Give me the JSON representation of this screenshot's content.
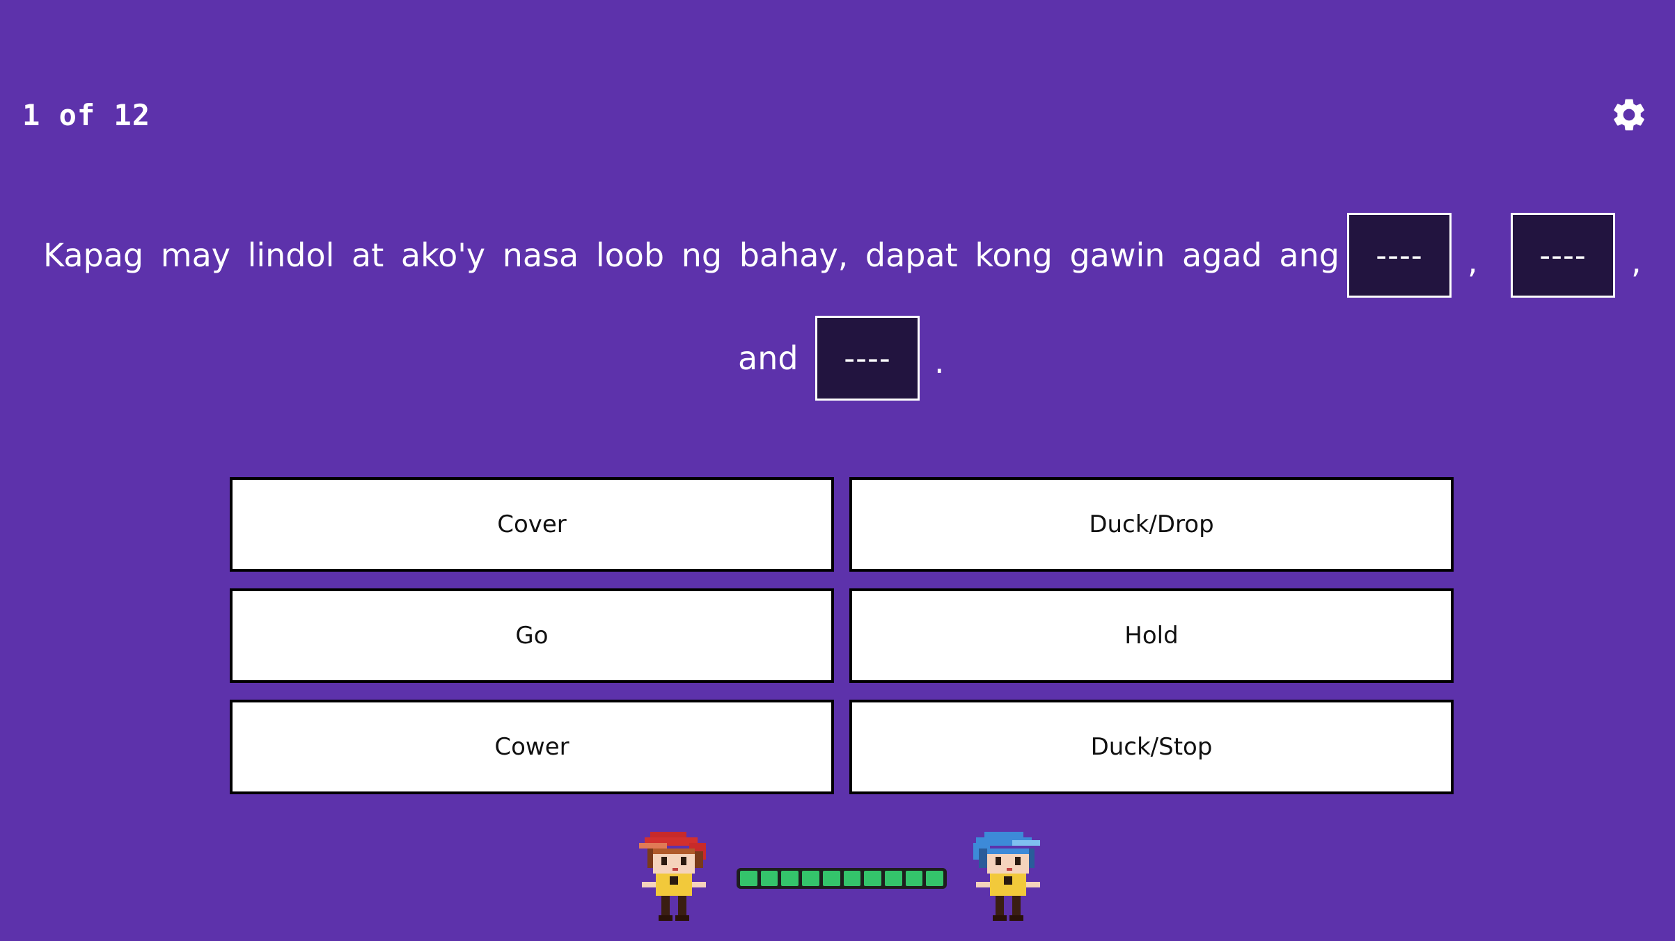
{
  "header": {
    "counter": "1 of 12"
  },
  "question": {
    "line1": "Kapag may lindol at ako'y nasa loob ng bahay, dapat kong gawin agad ang",
    "blank_text": "----",
    "comma": ",",
    "and_text": "and",
    "period": "."
  },
  "options": [
    "Cover",
    "Duck/Drop",
    "Go",
    "Hold",
    "Cower",
    "Duck/Stop"
  ],
  "footer": {
    "progress_fraction": 1.0,
    "progress_segments": 10
  },
  "colors": {
    "background": "#5d32ab",
    "blank_fill": "#22143f",
    "progress_green": "#34c46b",
    "player1_hair": "#d2302e",
    "player2_hair": "#3d8ad8"
  },
  "icons": [
    "gear-icon",
    "player-red-avatar",
    "player-blue-avatar"
  ]
}
